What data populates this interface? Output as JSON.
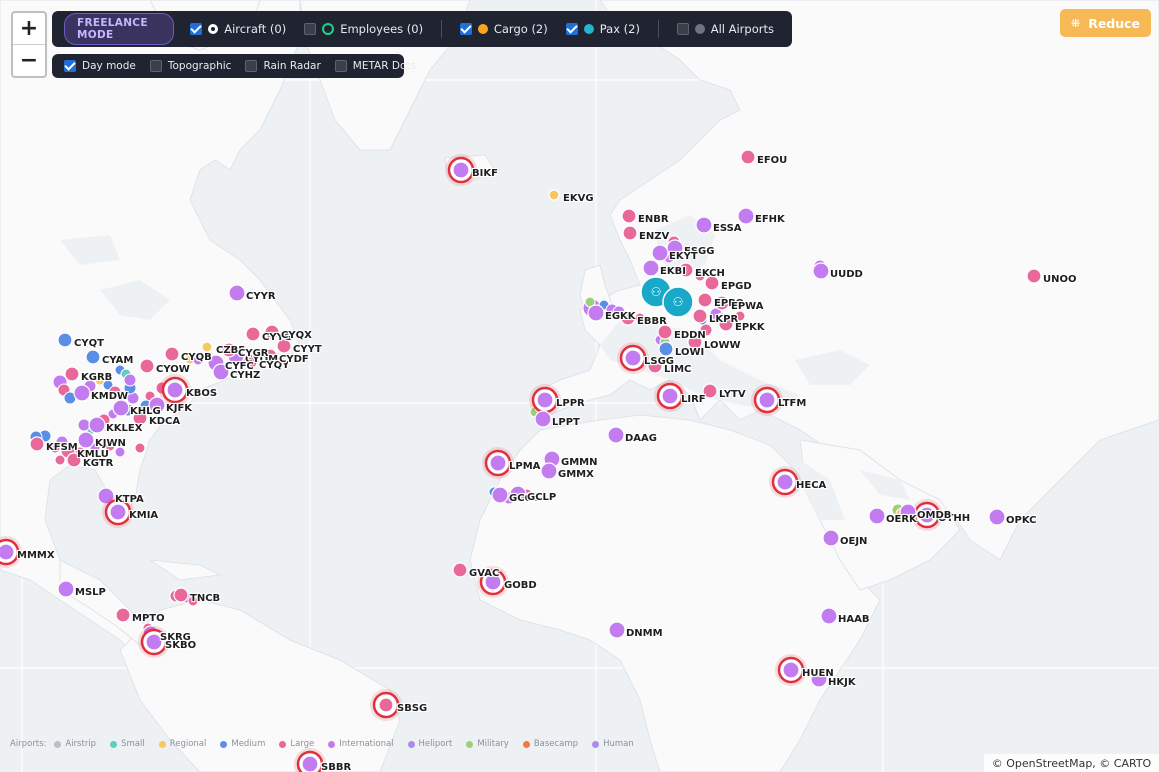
{
  "controls": {
    "zoom_in": "+",
    "zoom_out": "−",
    "mode_badge": "FREELANCE MODE",
    "filters": {
      "aircraft": {
        "label": "Aircraft (0)",
        "checked": true,
        "color": "#ffffff"
      },
      "employees": {
        "label": "Employees (0)",
        "checked": false,
        "color": "#1fd18c"
      },
      "cargo": {
        "label": "Cargo (2)",
        "checked": true,
        "color": "#f5a623"
      },
      "pax": {
        "label": "Pax (2)",
        "checked": true,
        "color": "#1fb6d0"
      },
      "all_airports": {
        "label": "All Airports",
        "checked": false,
        "color": "#6c7385"
      }
    },
    "layers": {
      "day_mode": {
        "label": "Day mode",
        "checked": true
      },
      "topographic": {
        "label": "Topographic",
        "checked": false
      },
      "rain_radar": {
        "label": "Rain Radar",
        "checked": false
      },
      "metar_dots": {
        "label": "METAR Dots",
        "checked": false
      }
    },
    "reduce_label": "Reduce"
  },
  "colors": {
    "international": "#c27cf0",
    "large": "#e8689a",
    "medium": "#5b8ee6",
    "regional": "#f6c85f",
    "small": "#5ecfbc",
    "heliport": "#a98cf0",
    "military": "#9ed07a",
    "basecamp": "#ef7a45",
    "highlight_ring": "#e0303e",
    "group": "#1aa8c8"
  },
  "airports": [
    {
      "code": "BIKF",
      "type": "international",
      "ring": true
    },
    {
      "code": "EKVG",
      "type": "regional"
    },
    {
      "code": "EFOU",
      "type": "large"
    },
    {
      "code": "ENBR",
      "type": "large"
    },
    {
      "code": "ENZV",
      "type": "large"
    },
    {
      "code": "ESSA",
      "type": "international"
    },
    {
      "code": "EFHK",
      "type": "international"
    },
    {
      "code": "ESGG",
      "type": "international"
    },
    {
      "code": "EKYT",
      "type": "international"
    },
    {
      "code": "EKBI",
      "type": "international"
    },
    {
      "code": "EKCH",
      "type": "large"
    },
    {
      "code": "UUDD",
      "type": "international"
    },
    {
      "code": "UNOO",
      "type": "large"
    },
    {
      "code": "EPGD",
      "type": "large"
    },
    {
      "code": "EPPO",
      "type": "large"
    },
    {
      "code": "EPWA",
      "type": "large"
    },
    {
      "code": "LKPR",
      "type": "large"
    },
    {
      "code": "EPKK",
      "type": "large"
    },
    {
      "code": "EGKK",
      "type": "international"
    },
    {
      "code": "EBBR",
      "type": "large"
    },
    {
      "code": "EDDN",
      "type": "large"
    },
    {
      "code": "LOWW",
      "type": "large"
    },
    {
      "code": "LOWI",
      "type": "medium"
    },
    {
      "code": "LSGG",
      "type": "international",
      "ring": true
    },
    {
      "code": "LIMC",
      "type": "large"
    },
    {
      "code": "LPPR",
      "type": "international",
      "ring": true
    },
    {
      "code": "LPPT",
      "type": "international"
    },
    {
      "code": "LIRF",
      "type": "international",
      "ring": true
    },
    {
      "code": "LYTV",
      "type": "large"
    },
    {
      "code": "LTFM",
      "type": "international",
      "ring": true
    },
    {
      "code": "DAAG",
      "type": "international"
    },
    {
      "code": "LPMA",
      "type": "international",
      "ring": true
    },
    {
      "code": "GMMN",
      "type": "international"
    },
    {
      "code": "GMMX",
      "type": "international"
    },
    {
      "code": "GCGC",
      "type": "international"
    },
    {
      "code": "GCLP",
      "type": "international"
    },
    {
      "code": "HECA",
      "type": "international",
      "ring": true
    },
    {
      "code": "OERK",
      "type": "international"
    },
    {
      "code": "OTHH",
      "type": "international",
      "ring": true
    },
    {
      "code": "OMDB",
      "type": "international"
    },
    {
      "code": "OPKC",
      "type": "international"
    },
    {
      "code": "OEJN",
      "type": "international"
    },
    {
      "code": "GVAC",
      "type": "large"
    },
    {
      "code": "GOBD",
      "type": "international",
      "ring": true
    },
    {
      "code": "DNMM",
      "type": "international"
    },
    {
      "code": "HAAB",
      "type": "international"
    },
    {
      "code": "HUEN",
      "type": "international",
      "ring": true
    },
    {
      "code": "HKJK",
      "type": "international"
    },
    {
      "code": "SBSG",
      "type": "large",
      "ring": true
    },
    {
      "code": "SBBR",
      "type": "international",
      "ring": true
    },
    {
      "code": "CYYR",
      "type": "international"
    },
    {
      "code": "CYQT",
      "type": "medium"
    },
    {
      "code": "CYAM",
      "type": "medium"
    },
    {
      "code": "CYOW",
      "type": "large"
    },
    {
      "code": "CYQB",
      "type": "large"
    },
    {
      "code": "CZBF",
      "type": "regional"
    },
    {
      "code": "CYQM",
      "type": "international"
    },
    {
      "code": "CYGR",
      "type": "large"
    },
    {
      "code": "CYQY",
      "type": "large"
    },
    {
      "code": "CYFC",
      "type": "international"
    },
    {
      "code": "CYHZ",
      "type": "international"
    },
    {
      "code": "CYYG",
      "type": "large"
    },
    {
      "code": "CYQX",
      "type": "large"
    },
    {
      "code": "CYYT",
      "type": "large"
    },
    {
      "code": "CYDF",
      "type": "large"
    },
    {
      "code": "KGRB",
      "type": "large"
    },
    {
      "code": "KMDW",
      "type": "international"
    },
    {
      "code": "KBOS",
      "type": "international",
      "ring": true
    },
    {
      "code": "KJFK",
      "type": "international"
    },
    {
      "code": "KHLG",
      "type": "international"
    },
    {
      "code": "KDCA",
      "type": "large"
    },
    {
      "code": "KKLEX",
      "type": "international"
    },
    {
      "code": "KJWN",
      "type": "international"
    },
    {
      "code": "KFSM",
      "type": "large"
    },
    {
      "code": "KMLU",
      "type": "large"
    },
    {
      "code": "KGTR",
      "type": "large"
    },
    {
      "code": "KTPA",
      "type": "international"
    },
    {
      "code": "KMIA",
      "type": "international",
      "ring": true
    },
    {
      "code": "MMMX",
      "type": "international",
      "ring": true
    },
    {
      "code": "MSLP",
      "type": "international"
    },
    {
      "code": "MPTO",
      "type": "large"
    },
    {
      "code": "TNCB",
      "type": "large"
    },
    {
      "code": "SKRG",
      "type": "international"
    },
    {
      "code": "SKBO",
      "type": "international",
      "ring": true
    }
  ],
  "groups": [
    {
      "icon": "users-icon"
    },
    {
      "icon": "users-icon"
    }
  ],
  "legend": {
    "title": "Airports:",
    "items": [
      {
        "label": "Airstrip",
        "color": "#b9bec8"
      },
      {
        "label": "Small",
        "color": "#5ecfbc"
      },
      {
        "label": "Regional",
        "color": "#f6c85f"
      },
      {
        "label": "Medium",
        "color": "#5b8ee6"
      },
      {
        "label": "Large",
        "color": "#e8689a"
      },
      {
        "label": "International",
        "color": "#c27cf0"
      },
      {
        "label": "Heliport",
        "color": "#a98cf0"
      },
      {
        "label": "Military",
        "color": "#9ed07a"
      },
      {
        "label": "Basecamp",
        "color": "#ef7a45"
      },
      {
        "label": "Human",
        "color": "#a98cf0"
      }
    ]
  },
  "attribution": "© OpenStreetMap, © CARTO"
}
